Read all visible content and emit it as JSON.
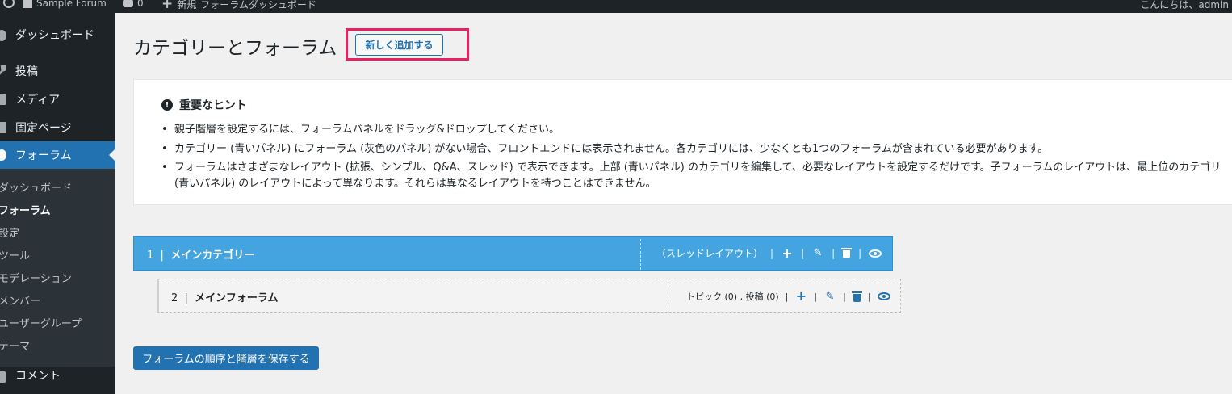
{
  "adminbar": {
    "site_name": "Sample Forum",
    "comments_count": "0",
    "new_label": "新規",
    "forum_dashboard_label": "フォーラムダッシュボード",
    "howdy": "こんにちは、admin"
  },
  "sidebar": {
    "items": [
      {
        "label": "ダッシュボード",
        "icon": "dashboard-icon"
      },
      {
        "label": "投稿",
        "icon": "pin-icon"
      },
      {
        "label": "メディア",
        "icon": "media-icon"
      },
      {
        "label": "固定ページ",
        "icon": "page-icon"
      },
      {
        "label": "フォーラム",
        "icon": "forum-icon"
      },
      {
        "label": "コメント",
        "icon": "comment-icon"
      }
    ],
    "submenu": [
      {
        "label": "ダッシュボード"
      },
      {
        "label": "フォーラム"
      },
      {
        "label": "設定"
      },
      {
        "label": "ツール"
      },
      {
        "label": "モデレーション"
      },
      {
        "label": "メンバー"
      },
      {
        "label": "ユーザーグループ"
      },
      {
        "label": "テーマ"
      }
    ]
  },
  "page": {
    "title": "カテゴリーとフォーラム",
    "add_new_label": "新しく追加する",
    "highlight_color": "#e91e63"
  },
  "notice": {
    "heading": "重要なヒント",
    "tips": [
      "親子階層を設定するには、フォーラムパネルをドラッグ&ドロップしてください。",
      "カテゴリー (青いパネル) にフォーラム (灰色のパネル) がない場合、フロントエンドには表示されません。各カテゴリには、少なくとも1つのフォーラムが含まれている必要があります。",
      "フォーラムはさまざまなレイアウト (拡張、シンプル、Q&A、スレッド) で表示できます。上部 (青いパネル) のカテゴリを編集して、必要なレイアウトを設定するだけです。子フォーラムのレイアウトは、最上位のカテゴリ (青いパネル) のレイアウトによって異なります。それらは異なるレイアウトを持つことはできません。"
    ]
  },
  "category": {
    "id": "1",
    "name": "メインカテゴリー",
    "layout": "（スレッドレイアウト）",
    "color": "#43a4e0"
  },
  "forum": {
    "id": "2",
    "name": "メインフォーラム",
    "stats": "トピック (0) , 投稿 (0)"
  },
  "save_label": "フォーラムの順序と階層を保存する",
  "accent": "#2271b1"
}
